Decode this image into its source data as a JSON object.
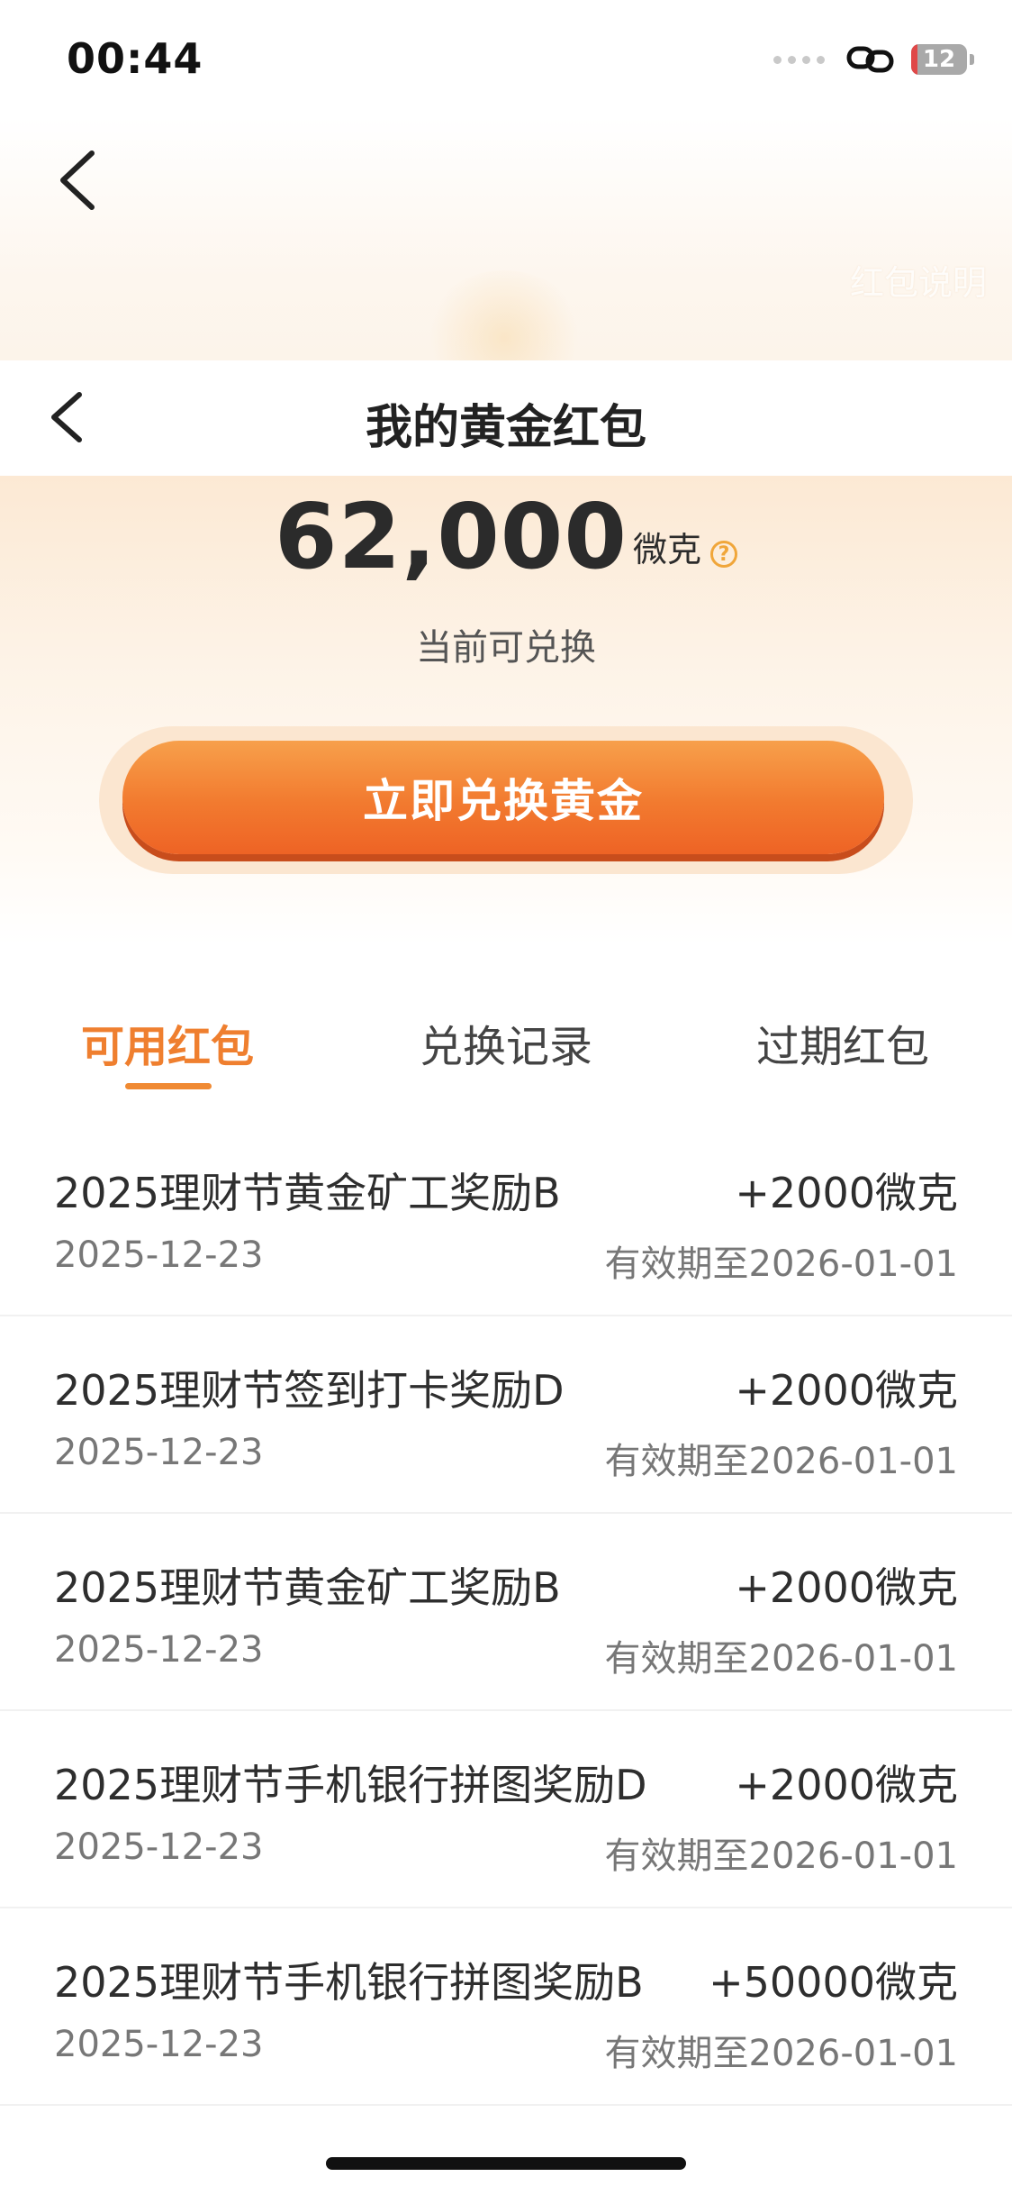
{
  "status_bar": {
    "time": "00:44",
    "battery_level": "12",
    "battery_fraction": 0.12
  },
  "header": {
    "title": "我的黄金红包",
    "rules_link": "红包说明"
  },
  "summary": {
    "amount": "62,000",
    "unit": "微克",
    "caption": "当前可兑换",
    "help_icon": "question-circle-icon"
  },
  "actions": {
    "exchange_label": "立即兑换黄金"
  },
  "tabs": [
    {
      "label": "可用红包",
      "active": true
    },
    {
      "label": "兑换记录",
      "active": false
    },
    {
      "label": "过期红包",
      "active": false
    }
  ],
  "items": [
    {
      "title": "2025理财节黄金矿工奖励B",
      "amount": "+2000微克",
      "date": "2025-12-23",
      "expiry": "有效期至2026-01-01"
    },
    {
      "title": "2025理财节签到打卡奖励D",
      "amount": "+2000微克",
      "date": "2025-12-23",
      "expiry": "有效期至2026-01-01"
    },
    {
      "title": "2025理财节黄金矿工奖励B",
      "amount": "+2000微克",
      "date": "2025-12-23",
      "expiry": "有效期至2026-01-01"
    },
    {
      "title": "2025理财节手机银行拼图奖励D",
      "amount": "+2000微克",
      "date": "2025-12-23",
      "expiry": "有效期至2026-01-01"
    },
    {
      "title": "2025理财节手机银行拼图奖励B",
      "amount": "+50000微克",
      "date": "2025-12-23",
      "expiry": "有效期至2026-01-01"
    }
  ],
  "colors": {
    "accent": "#ef7f2f",
    "button_top": "#f7a04b",
    "button_bottom": "#ee6325",
    "battery_low": "#e04848"
  }
}
